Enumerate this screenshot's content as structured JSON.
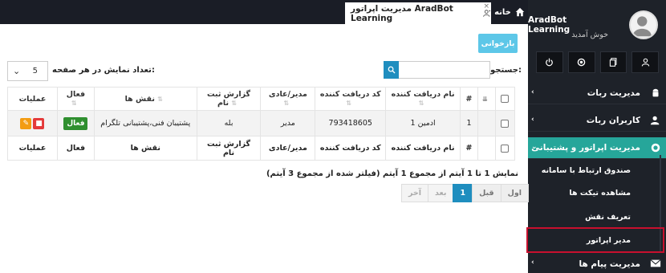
{
  "topbar": {
    "home_tab": "خانه",
    "active_tab": "مدیریت اپراتور AradBot Learning",
    "close_glyph": "×"
  },
  "sidebar": {
    "profile_name": "AradBot Learning",
    "welcome": "خوش آمدید",
    "menu": [
      {
        "label": "مدیریت ربات",
        "icon": "android-icon"
      },
      {
        "label": "کاربران ربات",
        "icon": "users-icon"
      },
      {
        "label": "مدیریت اپراتور و پشتیبانی",
        "icon": "support-icon"
      },
      {
        "label": "مدیریت پیام ها",
        "icon": "envelope-icon"
      }
    ],
    "submenu": [
      {
        "label": "صندوق ارتباط با سامانه"
      },
      {
        "label": "مشاهده تیکت ها"
      },
      {
        "label": "تعریف نقش"
      },
      {
        "label": "مدیر اپراتور"
      }
    ]
  },
  "toolbar": {
    "reload_label": "بازخوانی",
    "search_label": "جستجو:",
    "search_value": "",
    "page_size_label": "تعداد نمایش در هر صفحه:",
    "page_size_value": "5"
  },
  "table": {
    "headers": {
      "num": "#",
      "receiver_name": "نام دریافت کننده",
      "receiver_code": "کد دریافت کننده",
      "role_type": "مدیر/عادی",
      "report": "گزارش ثبت نام",
      "roles": "نقش ها",
      "active": "فعال",
      "actions": "عملیات"
    },
    "rows": [
      {
        "num": "1",
        "receiver_name": "ادمین 1",
        "receiver_code": "793418605",
        "role_type": "مدیر",
        "report": "بله",
        "roles": "پشتیبان فنی،پشتیبانی تلگرام",
        "active": "فعال"
      }
    ]
  },
  "footer": {
    "info": "نمایش 1 تا 1 آیتم از مجموع 1 آیتم (فیلتر شده از مجموع 3 آیتم)",
    "pager": {
      "first": "اول",
      "prev": "قبل",
      "current": "1",
      "next": "بعد",
      "last": "آخر"
    }
  },
  "colors": {
    "sidebar_bg": "#1e2229",
    "accent": "#26a69a",
    "primary": "#1f8ebf",
    "reload": "#5dc7e8",
    "highlight": "#c8102e"
  }
}
